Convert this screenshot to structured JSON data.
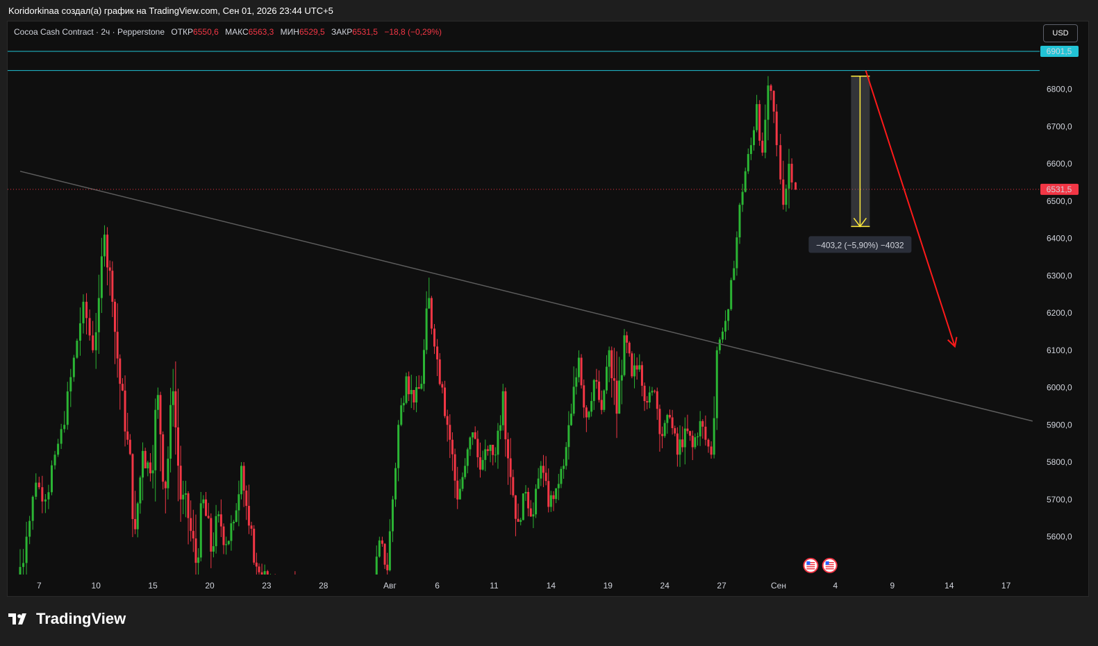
{
  "header": {
    "text": "Koridorkinaa создал(а) график на TradingView.com, Сен 01, 2026 23:44 UTC+5"
  },
  "legend": {
    "symbol": "Cocoa Cash Contract · 2ч · Pepperstone",
    "open_label": "ОТКР",
    "open_value": "6550,6",
    "high_label": "МАКС",
    "high_value": "6563,3",
    "low_label": "МИН",
    "low_value": "6529,5",
    "close_label": "ЗАКР",
    "close_value": "6531,5",
    "change": "−18,8 (−0,29%)"
  },
  "currency_button": "USD",
  "brand": "TradingView",
  "colors": {
    "up": "#26a69a",
    "up_bright": "#2bb534",
    "down": "#f23645",
    "trendline": "#5d5d5d",
    "horizontal_line": "#22c3d6",
    "measure": "#ffeb3b",
    "arrow": "#ff1a1a"
  },
  "chart_data": {
    "type": "candlestick",
    "y_axis": {
      "range": [
        5470,
        6950
      ],
      "ticks": [
        5600,
        5700,
        5800,
        5900,
        6000,
        6100,
        6200,
        6300,
        6400,
        6500,
        6600,
        6700,
        6800
      ],
      "tick_labels": [
        "5600,0",
        "5700,0",
        "5800,0",
        "5900,0",
        "6000,0",
        "6100,0",
        "6200,0",
        "6300,0",
        "6400,0",
        "6500,0",
        "6600,0",
        "6700,0",
        "6800,0"
      ]
    },
    "x_axis": {
      "tick_labels": [
        "7",
        "10",
        "15",
        "20",
        "23",
        "28",
        "Авг",
        "6",
        "11",
        "14",
        "19",
        "24",
        "27",
        "Сен",
        "4",
        "9",
        "14",
        "17"
      ],
      "tick_index": [
        1,
        4,
        7,
        10,
        13,
        16,
        19.5,
        22,
        25,
        28,
        31,
        34,
        37,
        40,
        43,
        46,
        49,
        52
      ]
    },
    "last_price": {
      "value": 6531.5,
      "label": "6531,5"
    },
    "horizontal_levels": [
      {
        "value": 6901.5,
        "label": "6901,5"
      },
      {
        "value": 6850
      }
    ],
    "trendline": {
      "from": [
        0,
        6580
      ],
      "to": [
        53.4,
        5910
      ]
    },
    "measurement": {
      "from": 6835,
      "to": 6432,
      "x": 44.3,
      "label": "−403,2 (−5,90%) −4032"
    },
    "projection_arrow": {
      "from": [
        44.6,
        6850
      ],
      "to": [
        49.3,
        6110
      ]
    },
    "event_flags": {
      "count": 2,
      "at": [
        41.7,
        42.7
      ],
      "icon": "us-flag-icon"
    },
    "candles_per_day": 12,
    "days": [
      {
        "i": 0,
        "o": 5480,
        "c": 5600,
        "h": 5640,
        "l": 5300
      },
      {
        "i": 0.5,
        "o": 5600,
        "c": 5745,
        "h": 5770,
        "l": 5580
      },
      {
        "i": 1,
        "o": 5745,
        "c": 5700,
        "h": 5780,
        "l": 5650
      },
      {
        "i": 1.5,
        "o": 5700,
        "c": 5820,
        "h": 5830,
        "l": 5640
      },
      {
        "i": 2,
        "o": 5820,
        "c": 5900,
        "h": 5960,
        "l": 5800
      },
      {
        "i": 2.5,
        "o": 5900,
        "c": 6080,
        "h": 6100,
        "l": 5880
      },
      {
        "i": 3,
        "o": 6080,
        "c": 6230,
        "h": 6250,
        "l": 6000
      },
      {
        "i": 3.5,
        "o": 6230,
        "c": 6100,
        "h": 6290,
        "l": 6080
      },
      {
        "i": 4,
        "o": 6100,
        "c": 6240,
        "h": 6320,
        "l": 6050
      },
      {
        "i": 4.3,
        "o": 6240,
        "c": 6410,
        "h": 6510,
        "l": 6200
      },
      {
        "i": 4.6,
        "o": 6410,
        "c": 6230,
        "h": 6430,
        "l": 6150
      },
      {
        "i": 5,
        "o": 6230,
        "c": 6010,
        "h": 6250,
        "l": 5900
      },
      {
        "i": 5.4,
        "o": 6010,
        "c": 5860,
        "h": 6060,
        "l": 5830
      },
      {
        "i": 5.8,
        "o": 5860,
        "c": 5620,
        "h": 5900,
        "l": 5540
      },
      {
        "i": 6.2,
        "o": 5620,
        "c": 5830,
        "h": 5890,
        "l": 5580
      },
      {
        "i": 6.6,
        "o": 5830,
        "c": 5770,
        "h": 5910,
        "l": 5700
      },
      {
        "i": 7,
        "o": 5770,
        "c": 5980,
        "h": 6000,
        "l": 5640
      },
      {
        "i": 7.4,
        "o": 5980,
        "c": 5730,
        "h": 6010,
        "l": 5560
      },
      {
        "i": 7.8,
        "o": 5730,
        "c": 5990,
        "h": 6050,
        "l": 5700
      },
      {
        "i": 8.2,
        "o": 5990,
        "c": 5700,
        "h": 6070,
        "l": 5640
      },
      {
        "i": 8.6,
        "o": 5700,
        "c": 5650,
        "h": 5750,
        "l": 5460
      },
      {
        "i": 9,
        "o": 5650,
        "c": 5530,
        "h": 5710,
        "l": 5420
      },
      {
        "i": 9.4,
        "o": 5530,
        "c": 5700,
        "h": 5720,
        "l": 5450
      },
      {
        "i": 9.8,
        "o": 5700,
        "c": 5560,
        "h": 5720,
        "l": 5450
      },
      {
        "i": 10.2,
        "o": 5560,
        "c": 5660,
        "h": 5700,
        "l": 5500
      },
      {
        "i": 10.6,
        "o": 5660,
        "c": 5580,
        "h": 5700,
        "l": 5500
      },
      {
        "i": 11,
        "o": 5580,
        "c": 5640,
        "h": 5700,
        "l": 5510
      },
      {
        "i": 11.4,
        "o": 5640,
        "c": 5790,
        "h": 5800,
        "l": 5600
      },
      {
        "i": 11.8,
        "o": 5790,
        "c": 5630,
        "h": 5800,
        "l": 5560
      },
      {
        "i": 12.2,
        "o": 5630,
        "c": 5520,
        "h": 5640,
        "l": 5460
      },
      {
        "i": 12.6,
        "o": 5520,
        "c": 5490,
        "h": 5540,
        "l": 5440
      },
      {
        "i": 13.2,
        "o": 5490,
        "c": 5480,
        "h": 5510,
        "l": 5460
      },
      {
        "i": 14.5,
        "o": 5490,
        "c": 5470,
        "h": 5640,
        "l": 5460
      },
      {
        "i": 16.5,
        "o": 5480,
        "c": 5475,
        "h": 5510,
        "l": 5460
      },
      {
        "i": 18.8,
        "o": 5480,
        "c": 5590,
        "h": 5600,
        "l": 5470
      },
      {
        "i": 19.1,
        "o": 5590,
        "c": 5510,
        "h": 5600,
        "l": 5470
      },
      {
        "i": 19.5,
        "o": 5510,
        "c": 5700,
        "h": 5710,
        "l": 5470
      },
      {
        "i": 19.8,
        "o": 5700,
        "c": 5900,
        "h": 5920,
        "l": 5680
      },
      {
        "i": 20.1,
        "o": 5900,
        "c": 6030,
        "h": 6040,
        "l": 5880
      },
      {
        "i": 20.5,
        "o": 6030,
        "c": 5960,
        "h": 6110,
        "l": 5940
      },
      {
        "i": 20.9,
        "o": 5960,
        "c": 6010,
        "h": 6040,
        "l": 5900
      },
      {
        "i": 21.3,
        "o": 6010,
        "c": 6240,
        "h": 6300,
        "l": 5990
      },
      {
        "i": 21.7,
        "o": 6240,
        "c": 6110,
        "h": 6280,
        "l": 6090
      },
      {
        "i": 22,
        "o": 6110,
        "c": 6000,
        "h": 6130,
        "l": 5940
      },
      {
        "i": 22.4,
        "o": 6000,
        "c": 5860,
        "h": 6020,
        "l": 5800
      },
      {
        "i": 22.8,
        "o": 5860,
        "c": 5700,
        "h": 5880,
        "l": 5640
      },
      {
        "i": 23.2,
        "o": 5700,
        "c": 5790,
        "h": 5820,
        "l": 5700
      },
      {
        "i": 23.6,
        "o": 5790,
        "c": 5880,
        "h": 5950,
        "l": 5770
      },
      {
        "i": 24,
        "o": 5880,
        "c": 5780,
        "h": 5900,
        "l": 5700
      },
      {
        "i": 24.4,
        "o": 5780,
        "c": 5830,
        "h": 5870,
        "l": 5740
      },
      {
        "i": 24.8,
        "o": 5830,
        "c": 5820,
        "h": 5840,
        "l": 5700
      },
      {
        "i": 25.2,
        "o": 5820,
        "c": 5990,
        "h": 6010,
        "l": 5770
      },
      {
        "i": 25.6,
        "o": 5990,
        "c": 5760,
        "h": 6000,
        "l": 5700
      },
      {
        "i": 26,
        "o": 5760,
        "c": 5640,
        "h": 5780,
        "l": 5530
      },
      {
        "i": 26.4,
        "o": 5640,
        "c": 5720,
        "h": 5750,
        "l": 5620
      },
      {
        "i": 26.8,
        "o": 5720,
        "c": 5660,
        "h": 5760,
        "l": 5580
      },
      {
        "i": 27.2,
        "o": 5660,
        "c": 5790,
        "h": 5810,
        "l": 5650
      },
      {
        "i": 27.6,
        "o": 5790,
        "c": 5680,
        "h": 5840,
        "l": 5640
      },
      {
        "i": 28,
        "o": 5680,
        "c": 5730,
        "h": 5760,
        "l": 5620
      },
      {
        "i": 28.4,
        "o": 5730,
        "c": 5790,
        "h": 5820,
        "l": 5690
      },
      {
        "i": 28.8,
        "o": 5790,
        "c": 5930,
        "h": 5960,
        "l": 5780
      },
      {
        "i": 29.2,
        "o": 5930,
        "c": 6080,
        "h": 6120,
        "l": 5900
      },
      {
        "i": 29.6,
        "o": 6080,
        "c": 5920,
        "h": 6090,
        "l": 5860
      },
      {
        "i": 30,
        "o": 5920,
        "c": 6020,
        "h": 6040,
        "l": 5880
      },
      {
        "i": 30.4,
        "o": 6020,
        "c": 5940,
        "h": 6050,
        "l": 5860
      },
      {
        "i": 30.8,
        "o": 5940,
        "c": 6100,
        "h": 6110,
        "l": 5920
      },
      {
        "i": 31.2,
        "o": 6100,
        "c": 5930,
        "h": 6110,
        "l": 5750
      },
      {
        "i": 31.6,
        "o": 5930,
        "c": 6140,
        "h": 6160,
        "l": 5900
      },
      {
        "i": 32,
        "o": 6140,
        "c": 6030,
        "h": 6150,
        "l": 5980
      },
      {
        "i": 32.4,
        "o": 6030,
        "c": 6060,
        "h": 6120,
        "l": 5960
      },
      {
        "i": 32.8,
        "o": 6060,
        "c": 5960,
        "h": 6070,
        "l": 5900
      },
      {
        "i": 33.2,
        "o": 5960,
        "c": 5990,
        "h": 6010,
        "l": 5890
      },
      {
        "i": 33.6,
        "o": 5990,
        "c": 5870,
        "h": 6000,
        "l": 5800
      },
      {
        "i": 34,
        "o": 5870,
        "c": 5920,
        "h": 5950,
        "l": 5810
      },
      {
        "i": 34.4,
        "o": 5920,
        "c": 5820,
        "h": 5940,
        "l": 5780
      },
      {
        "i": 34.8,
        "o": 5820,
        "c": 5890,
        "h": 5920,
        "l": 5730
      },
      {
        "i": 35.2,
        "o": 5890,
        "c": 5840,
        "h": 5940,
        "l": 5780
      },
      {
        "i": 35.6,
        "o": 5840,
        "c": 5910,
        "h": 5960,
        "l": 5820
      },
      {
        "i": 36,
        "o": 5910,
        "c": 5860,
        "h": 5950,
        "l": 5800
      },
      {
        "i": 36.3,
        "o": 5860,
        "c": 5820,
        "h": 5880,
        "l": 5800
      },
      {
        "i": 36.6,
        "o": 5820,
        "c": 6100,
        "h": 6110,
        "l": 5810
      },
      {
        "i": 36.9,
        "o": 6100,
        "c": 6150,
        "h": 6170,
        "l": 6080
      },
      {
        "i": 37.2,
        "o": 6150,
        "c": 6210,
        "h": 6230,
        "l": 6110
      },
      {
        "i": 37.5,
        "o": 6210,
        "c": 6320,
        "h": 6340,
        "l": 6200
      },
      {
        "i": 37.8,
        "o": 6320,
        "c": 6490,
        "h": 6520,
        "l": 6300
      },
      {
        "i": 38.1,
        "o": 6490,
        "c": 6580,
        "h": 6600,
        "l": 6460
      },
      {
        "i": 38.4,
        "o": 6580,
        "c": 6650,
        "h": 6680,
        "l": 6560
      },
      {
        "i": 38.7,
        "o": 6650,
        "c": 6760,
        "h": 6790,
        "l": 6630
      },
      {
        "i": 39,
        "o": 6760,
        "c": 6630,
        "h": 6800,
        "l": 6600
      },
      {
        "i": 39.3,
        "o": 6630,
        "c": 6810,
        "h": 6835,
        "l": 6610
      },
      {
        "i": 39.6,
        "o": 6810,
        "c": 6740,
        "h": 6830,
        "l": 6690
      },
      {
        "i": 39.9,
        "o": 6740,
        "c": 6650,
        "h": 6760,
        "l": 6620
      },
      {
        "i": 40.1,
        "o": 6650,
        "c": 6490,
        "h": 6700,
        "l": 6470
      },
      {
        "i": 40.4,
        "o": 6490,
        "c": 6600,
        "h": 6640,
        "l": 6420
      },
      {
        "i": 40.7,
        "o": 6600,
        "c": 6550,
        "h": 6620,
        "l": 6480
      },
      {
        "i": 40.9,
        "o": 6550,
        "c": 6531.5,
        "h": 6563.3,
        "l": 6529.5
      }
    ]
  }
}
